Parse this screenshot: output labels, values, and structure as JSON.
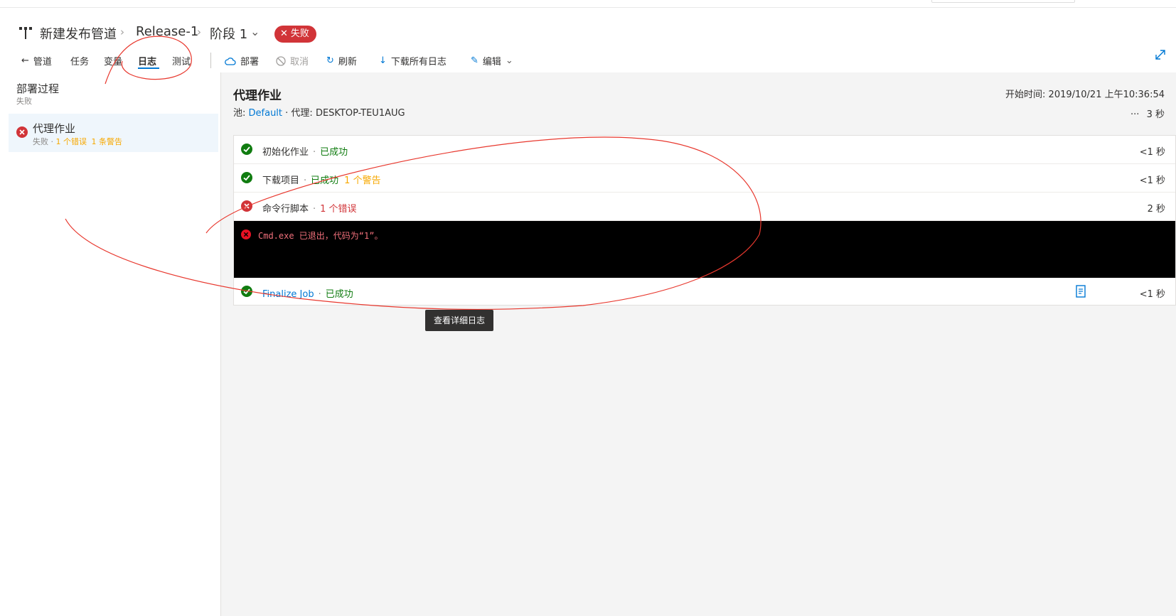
{
  "breadcrumb": {
    "pipeline": "新建发布管道",
    "release": "Release-1",
    "stage": "阶段 1",
    "status_badge": "失败"
  },
  "toolbar": {
    "back_label": "管道",
    "tabs": [
      {
        "label": "任务"
      },
      {
        "label": "变量"
      },
      {
        "label": "日志",
        "active": true
      },
      {
        "label": "测试"
      }
    ],
    "actions": {
      "deploy": "部署",
      "cancel": "取消",
      "refresh": "刷新",
      "download_logs": "下载所有日志",
      "edit": "编辑"
    }
  },
  "sidebar": {
    "title": "部署过程",
    "subtitle": "失败",
    "job": {
      "title": "代理作业",
      "status": "失败",
      "sep": " · ",
      "errors": "1 个错误",
      "warnings": "1 条警告"
    }
  },
  "job": {
    "title": "代理作业",
    "pool_label": "池: ",
    "pool_value": "Default",
    "agent_sep": " · 代理: ",
    "agent_value": "DESKTOP-TEU1AUG",
    "start_label": "开始时间: ",
    "start_value": "2019/10/21 上午10:36:54",
    "ellipsis": "···",
    "duration": "3 秒"
  },
  "steps": [
    {
      "name": "初始化作业",
      "status": "已成功",
      "extra": "",
      "duration": "<1 秒"
    },
    {
      "name": "下载项目",
      "status": "已成功",
      "extra": "1 个警告",
      "duration": "<1 秒"
    },
    {
      "name": "命令行脚本",
      "status": "1 个错误",
      "extra": "",
      "duration": "2 秒"
    },
    {
      "name": "Finalize Job",
      "status": "已成功",
      "extra": "",
      "duration": "<1 秒"
    }
  ],
  "console": {
    "line": "Cmd.exe 已退出，代码为“1”。"
  },
  "tooltip": "查看详细日志",
  "colors": {
    "accent": "#0078d4",
    "error": "#d13438",
    "success": "#107c10",
    "warning": "#f7a800"
  }
}
